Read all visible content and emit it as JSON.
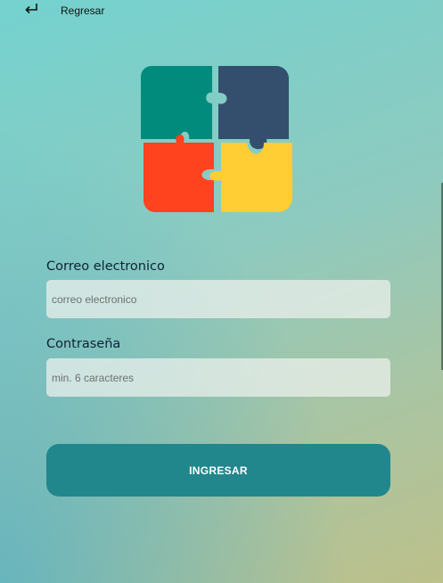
{
  "header": {
    "back_icon": "arrow-return-left-icon",
    "back_label": "Regresar"
  },
  "logo": {
    "name": "puzzle-icon",
    "colors": {
      "teal": "#008b7d",
      "navy": "#344f6e",
      "orange": "#ff431e",
      "yellow": "#ffcd34"
    }
  },
  "form": {
    "email_label": "Correo electronico",
    "email_placeholder": "correo electronico",
    "password_label": "Contraseña",
    "password_placeholder": "min. 6 caracteres",
    "submit_label": "INGRESAR"
  },
  "theme": {
    "background_top": "#74d2cf",
    "background_bottom": "#bcc08a",
    "button_color": "#21878c"
  }
}
